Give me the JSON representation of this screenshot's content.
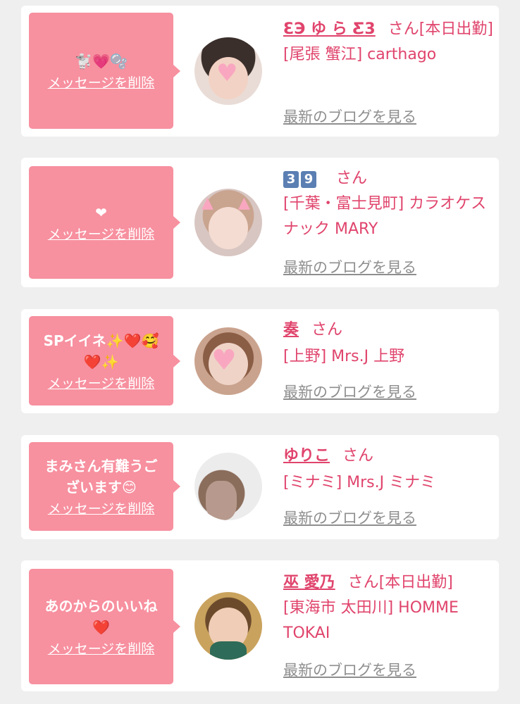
{
  "delete_label": "メッセージを削除",
  "blog_label": "最新のブログを見る",
  "san_label": "さん",
  "colors": {
    "bubble": "#f7909f",
    "name": "#e0446c",
    "blog": "#8e8e8e",
    "background": "#efefef"
  },
  "entries": [
    {
      "message": "🐩💗🫧",
      "name": "ƐЭ ゆ ら Ƹ3",
      "suffix": "[本日出勤]",
      "shop": "[尾張 蟹江] carthago"
    },
    {
      "message": "❤",
      "name_badges": [
        "3",
        "9"
      ],
      "suffix": "",
      "shop": "[千葉・富士見町] カラオケスナック MARY"
    },
    {
      "message": "SPイイネ✨❤️🥰❤️✨",
      "name": "奏",
      "suffix": "",
      "shop": "[上野] Mrs.J 上野"
    },
    {
      "message": "まみさん有難うございます😊",
      "name": "ゆりこ",
      "suffix": "",
      "shop": "[ミナミ] Mrs.J ミナミ"
    },
    {
      "message": "あのからのいいね❤️",
      "name": "巫 愛乃",
      "suffix": "[本日出勤]",
      "shop": "[東海市 太田川] HOMME TOKAI"
    }
  ]
}
